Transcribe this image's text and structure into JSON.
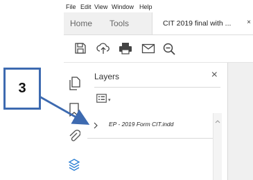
{
  "menu": {
    "items": [
      "File",
      "Edit",
      "View",
      "Window",
      "Help"
    ]
  },
  "tabs": {
    "home": "Home",
    "tools": "Tools",
    "document": "CIT 2019 final with ...",
    "close_glyph": "×"
  },
  "toolbar": {
    "icons": [
      "save-icon",
      "upload-icon",
      "print-icon",
      "email-icon",
      "zoom-icon"
    ]
  },
  "leftrail": {
    "icons": [
      "pages-icon",
      "bookmark-icon",
      "attachment-icon",
      "layers-icon"
    ]
  },
  "layers_panel": {
    "title": "Layers",
    "close_glyph": "×",
    "options_caret": "▾",
    "layer_name": "EP - 2019 Form CIT.indd"
  },
  "callout": {
    "label": "3"
  },
  "colors": {
    "accent": "#3d6ab0",
    "layers_icon": "#2a7fd4",
    "tab_bg": "#f0f0f0"
  }
}
